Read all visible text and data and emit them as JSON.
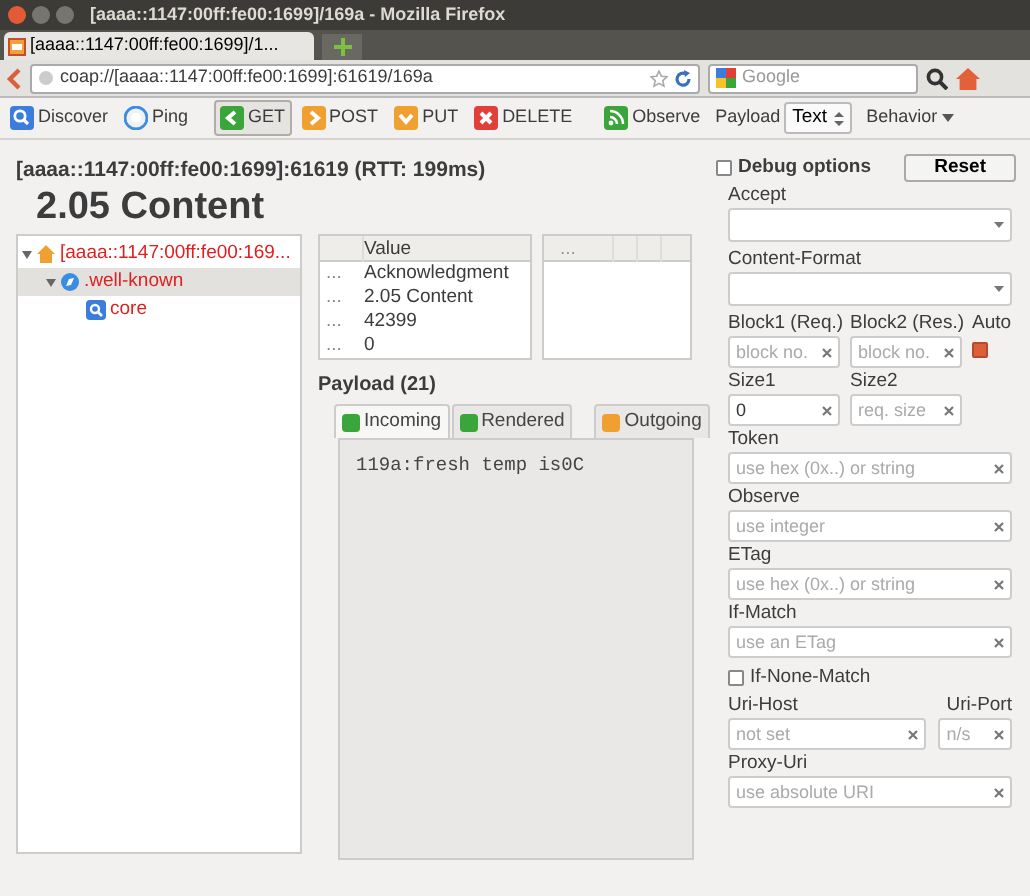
{
  "window": {
    "title": "[aaaa::1147:00ff:fe00:1699]/169a - Mozilla Firefox"
  },
  "browser_tabs": [
    {
      "label": "[aaaa::1147:00ff:fe00:1699]/1...",
      "selected": true
    }
  ],
  "url": "coap://[aaaa::1147:00ff:fe00:1699]:61619/169a",
  "search": {
    "placeholder": "Google"
  },
  "toolbar": {
    "buttons": [
      {
        "label": "Discover",
        "kind": "discover",
        "selected": false
      },
      {
        "label": "Ping",
        "kind": "ping",
        "selected": false
      },
      {
        "label": "GET",
        "kind": "get",
        "selected": true
      },
      {
        "label": "POST",
        "kind": "post",
        "selected": false
      },
      {
        "label": "PUT",
        "kind": "put",
        "selected": false
      },
      {
        "label": "DELETE",
        "kind": "delete",
        "selected": false
      },
      {
        "label": "Observe",
        "kind": "observe",
        "selected": false
      }
    ],
    "payload_label": "Payload",
    "payload_format": "Text",
    "behavior": "Behavior"
  },
  "response": {
    "address": "[aaaa::1147:00ff:fe00:1699]:61619 (RTT: 199ms)",
    "status": "2.05 Content"
  },
  "tree": [
    {
      "label": "[aaaa::1147:00ff:fe00:169...",
      "kind": "host",
      "expanded": true,
      "selected": false,
      "children": [
        {
          "label": ".well-known",
          "kind": "folder",
          "expanded": true,
          "selected": true,
          "children": [
            {
              "label": "core",
              "kind": "resource",
              "selected": false
            }
          ]
        }
      ]
    }
  ],
  "headers_table": {
    "columns": [
      "",
      "Value"
    ],
    "rows": [
      [
        "...",
        "Acknowledgment"
      ],
      [
        "...",
        "2.05 Content"
      ],
      [
        "...",
        "42399"
      ],
      [
        "...",
        "0"
      ]
    ]
  },
  "options_table": {
    "columns": [
      "...",
      "",
      ""
    ]
  },
  "payload": {
    "title": "Payload (21)",
    "tabs": [
      {
        "label": "Incoming",
        "selected": true,
        "color": "#3aa53a"
      },
      {
        "label": "Rendered",
        "selected": false,
        "color": "#3aa53a"
      },
      {
        "label": "Outgoing",
        "selected": false,
        "color": "#f0a030"
      }
    ],
    "content": "119a:fresh temp is0C"
  },
  "debug": {
    "label": "Debug options",
    "checked": false,
    "reset": "Reset",
    "rows": [
      {
        "kind": "select",
        "fields": [
          {
            "label": "Accept"
          }
        ]
      },
      {
        "kind": "select",
        "fields": [
          {
            "label": "Content-Format"
          }
        ]
      },
      {
        "kind": "inputs",
        "fields": [
          {
            "label": "Block1 (Req.)",
            "placeholder": "block no."
          },
          {
            "label": "Block2 (Res.)",
            "placeholder": "block no."
          }
        ],
        "auto": {
          "label": "Auto",
          "checked": true
        }
      },
      {
        "kind": "inputs",
        "fields": [
          {
            "label": "Size1",
            "value": "0"
          },
          {
            "label": "Size2",
            "placeholder": "req. size"
          }
        ]
      },
      {
        "kind": "inputs",
        "fields": [
          {
            "label": "Token",
            "placeholder": "use hex (0x..) or string"
          }
        ]
      },
      {
        "kind": "inputs",
        "fields": [
          {
            "label": "Observe",
            "placeholder": "use integer"
          }
        ]
      },
      {
        "kind": "inputs",
        "fields": [
          {
            "label": "ETag",
            "placeholder": "use hex (0x..) or string"
          }
        ]
      },
      {
        "kind": "inputs",
        "fields": [
          {
            "label": "If-Match",
            "placeholder": "use an ETag"
          }
        ]
      },
      {
        "kind": "checkbox",
        "label": "If-None-Match",
        "checked": false
      },
      {
        "kind": "hostport",
        "fields": [
          {
            "label": "Uri-Host",
            "placeholder": "not set"
          },
          {
            "label": "Uri-Port",
            "placeholder": "n/s"
          }
        ]
      },
      {
        "kind": "inputs",
        "fields": [
          {
            "label": "Proxy-Uri",
            "placeholder": "use absolute URI"
          }
        ]
      }
    ]
  }
}
